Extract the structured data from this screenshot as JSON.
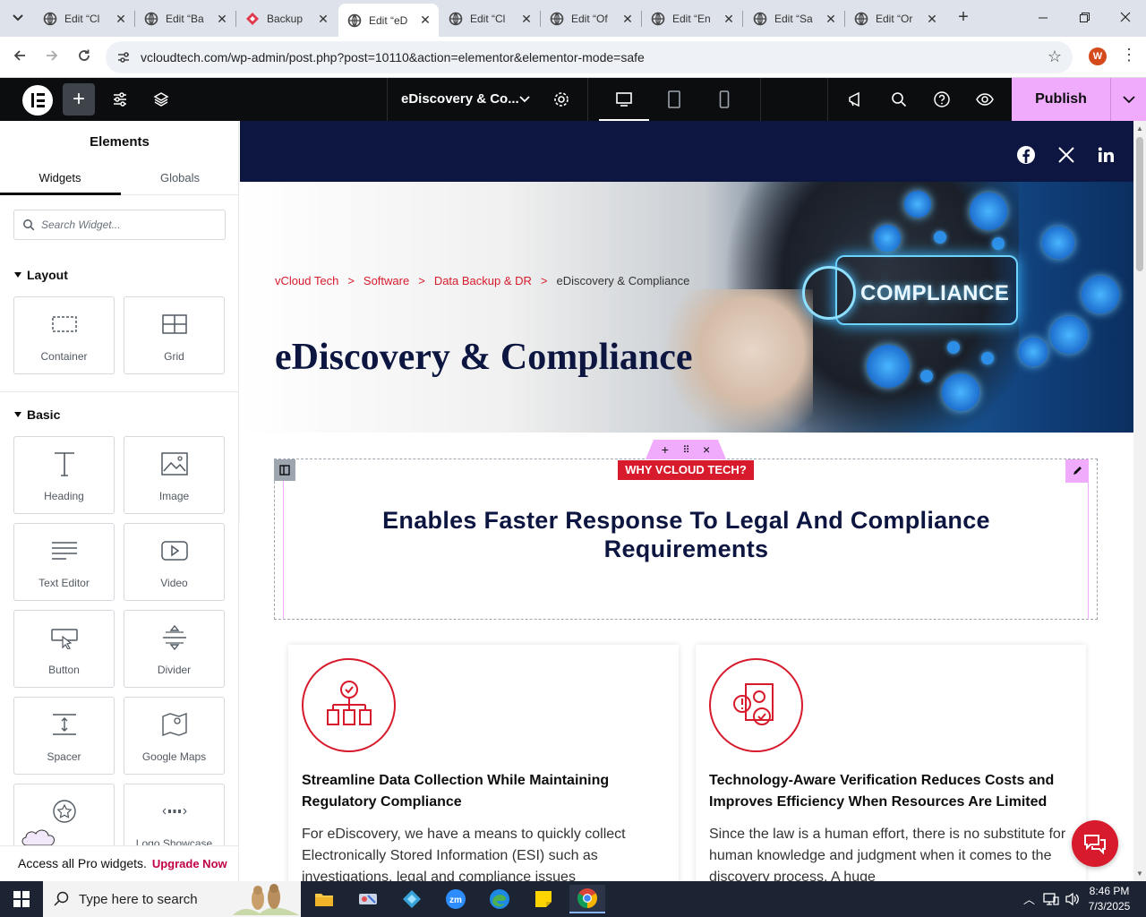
{
  "browser": {
    "tabs": [
      {
        "title": "Edit “Cl",
        "active": false
      },
      {
        "title": "Edit “Ba",
        "active": false
      },
      {
        "title": "Backup",
        "active": false
      },
      {
        "title": "Edit “eD",
        "active": true
      },
      {
        "title": "Edit “Cl",
        "active": false
      },
      {
        "title": "Edit “Of",
        "active": false
      },
      {
        "title": "Edit “En",
        "active": false
      },
      {
        "title": "Edit “Sa",
        "active": false
      },
      {
        "title": "Edit “Or",
        "active": false
      }
    ],
    "url": "vcloudtech.com/wp-admin/post.php?post=10110&action=elementor&elementor-mode=safe",
    "profile_initial": "W"
  },
  "elementor": {
    "page_title": "eDiscovery & Co...",
    "publish_label": "Publish"
  },
  "panel": {
    "title": "Elements",
    "tabs": [
      "Widgets",
      "Globals"
    ],
    "search_placeholder": "Search Widget...",
    "categories": {
      "layout": "Layout",
      "basic": "Basic"
    },
    "layout_widgets": [
      "Container",
      "Grid"
    ],
    "basic_widgets": [
      "Heading",
      "Image",
      "Text Editor",
      "Video",
      "Button",
      "Divider",
      "Spacer",
      "Google Maps",
      "",
      "Logo Showcase"
    ],
    "upgrade_text": "Access all Pro widgets.",
    "upgrade_link": "Upgrade Now"
  },
  "page": {
    "breadcrumbs": [
      "vCloud Tech",
      "Software",
      "Data Backup & DR",
      "eDiscovery & Compliance"
    ],
    "hero_title": "eDiscovery & Compliance",
    "hero_image_text": "COMPLIANCE",
    "badge": "WHY VCLOUD TECH?",
    "section_title": "Enables Faster Response To Legal And Compliance Requirements",
    "cards": [
      {
        "heading": "Streamline Data Collection While Maintaining Regulatory Compliance",
        "body": "For eDiscovery, we have a means to quickly collect Electronically Stored Information (ESI) such as investigations, legal and compliance issues"
      },
      {
        "heading": "Technology-Aware Verification Reduces Costs and Improves Efficiency When Resources Are Limited",
        "body": "Since the law is a human effort, there is no substitute for human knowledge and judgment when it comes to the discovery process. A huge"
      }
    ]
  },
  "taskbar": {
    "search_text": "Type here to search",
    "time": "8:46 PM",
    "date": "7/3/2025"
  },
  "colors": {
    "brand_red": "#d71a2c",
    "navy": "#0d1640",
    "elementor_pink": "#f0abfc",
    "elementor_dark": "#0c0d0e"
  }
}
